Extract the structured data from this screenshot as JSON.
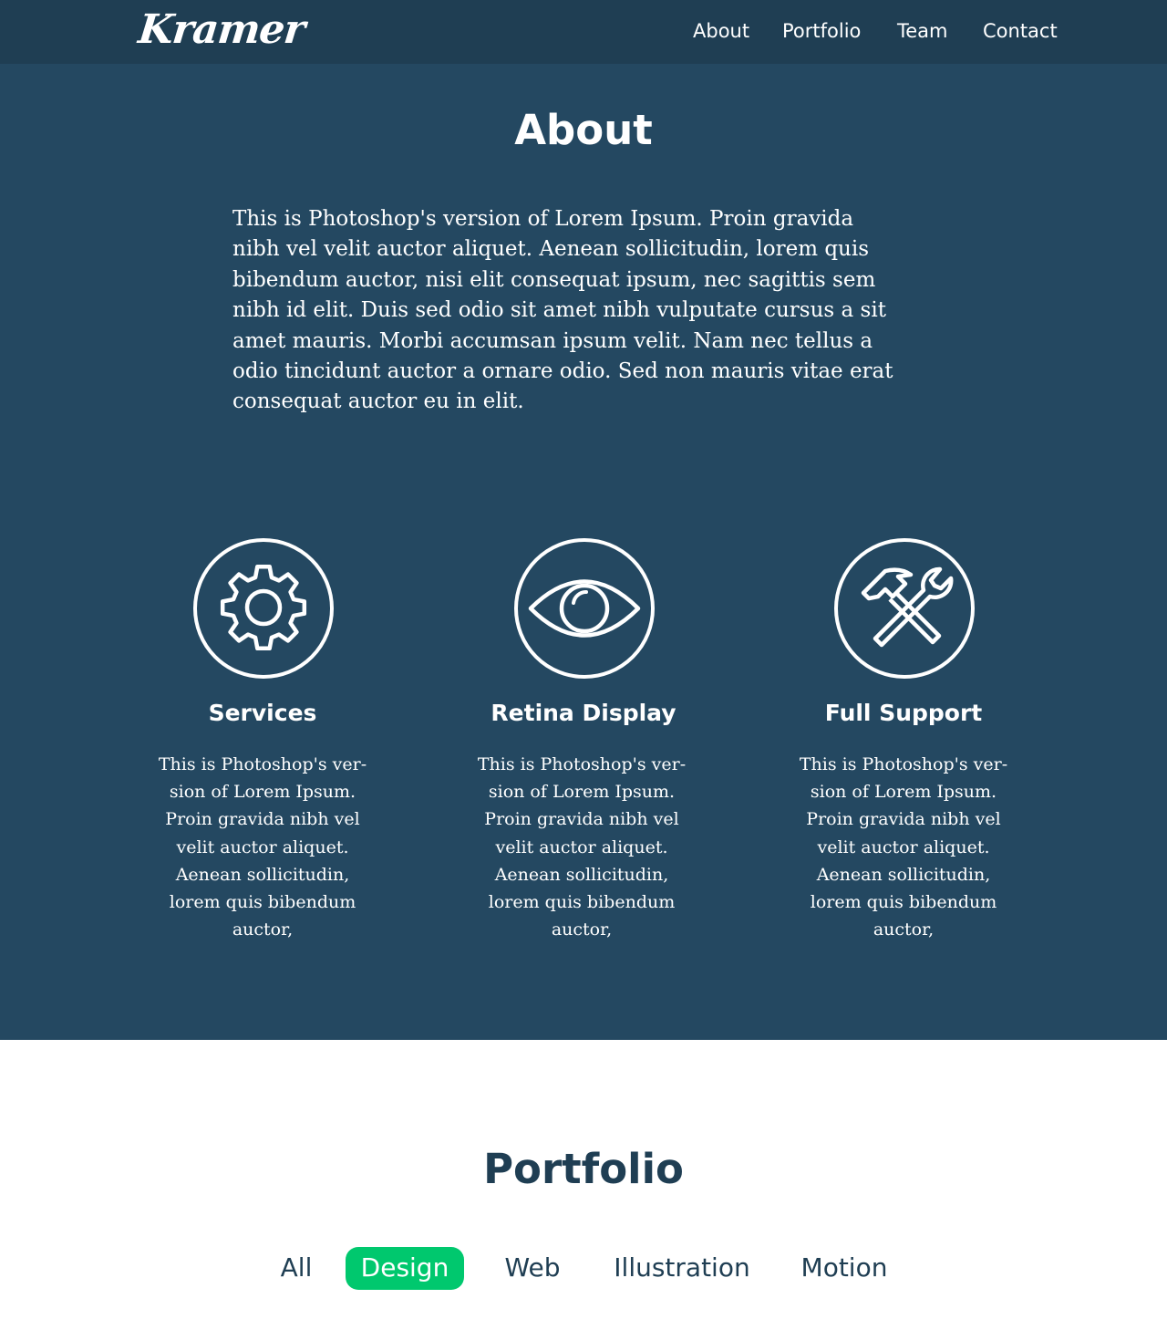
{
  "header": {
    "logo": "Kramer",
    "nav": [
      "About",
      "Portfolio",
      "Team",
      "Contact"
    ]
  },
  "about": {
    "title": "About",
    "text": "This is Photoshop's version  of Lorem Ipsum. Proin gravida\nnibh vel velit auctor aliquet. Aenean sollicitudin, lorem quis\nbibendum auctor, nisi elit consequat ipsum, nec sagittis sem\nnibh id elit. Duis sed odio sit amet nibh vulputate cursus a sit\namet mauris. Morbi accumsan ipsum velit. Nam nec tellus a\nodio tincidunt auctor a ornare odio. Sed non  mauris vitae erat\nconsequat auctor eu in elit.",
    "features": [
      {
        "icon": "gear-icon",
        "title": "Services",
        "text": "This is Photoshop's ver-\nsion  of Lorem Ipsum.\nProin gravida nibh vel\nvelit auctor aliquet.\nAenean sollicitudin,\nlorem quis bibendum\nauctor,"
      },
      {
        "icon": "eye-icon",
        "title": "Retina Display",
        "text": "This is Photoshop's ver-\nsion  of Lorem Ipsum.\nProin gravida nibh vel\nvelit auctor aliquet.\nAenean sollicitudin,\nlorem quis bibendum\nauctor,"
      },
      {
        "icon": "tools-icon",
        "title": "Full Support",
        "text": "This is Photoshop's ver-\nsion  of Lorem Ipsum.\nProin gravida nibh vel\nvelit auctor aliquet.\nAenean sollicitudin,\nlorem quis bibendum\nauctor,"
      }
    ]
  },
  "portfolio": {
    "title": "Portfolio",
    "filters": [
      "All",
      "Design",
      "Web",
      "Illustration",
      "Motion"
    ],
    "active_filter": "Design"
  },
  "colors": {
    "header_bg": "#1f3e53",
    "section_bg": "#244861",
    "accent": "#00c86e",
    "dark_text": "#1f3e53"
  }
}
